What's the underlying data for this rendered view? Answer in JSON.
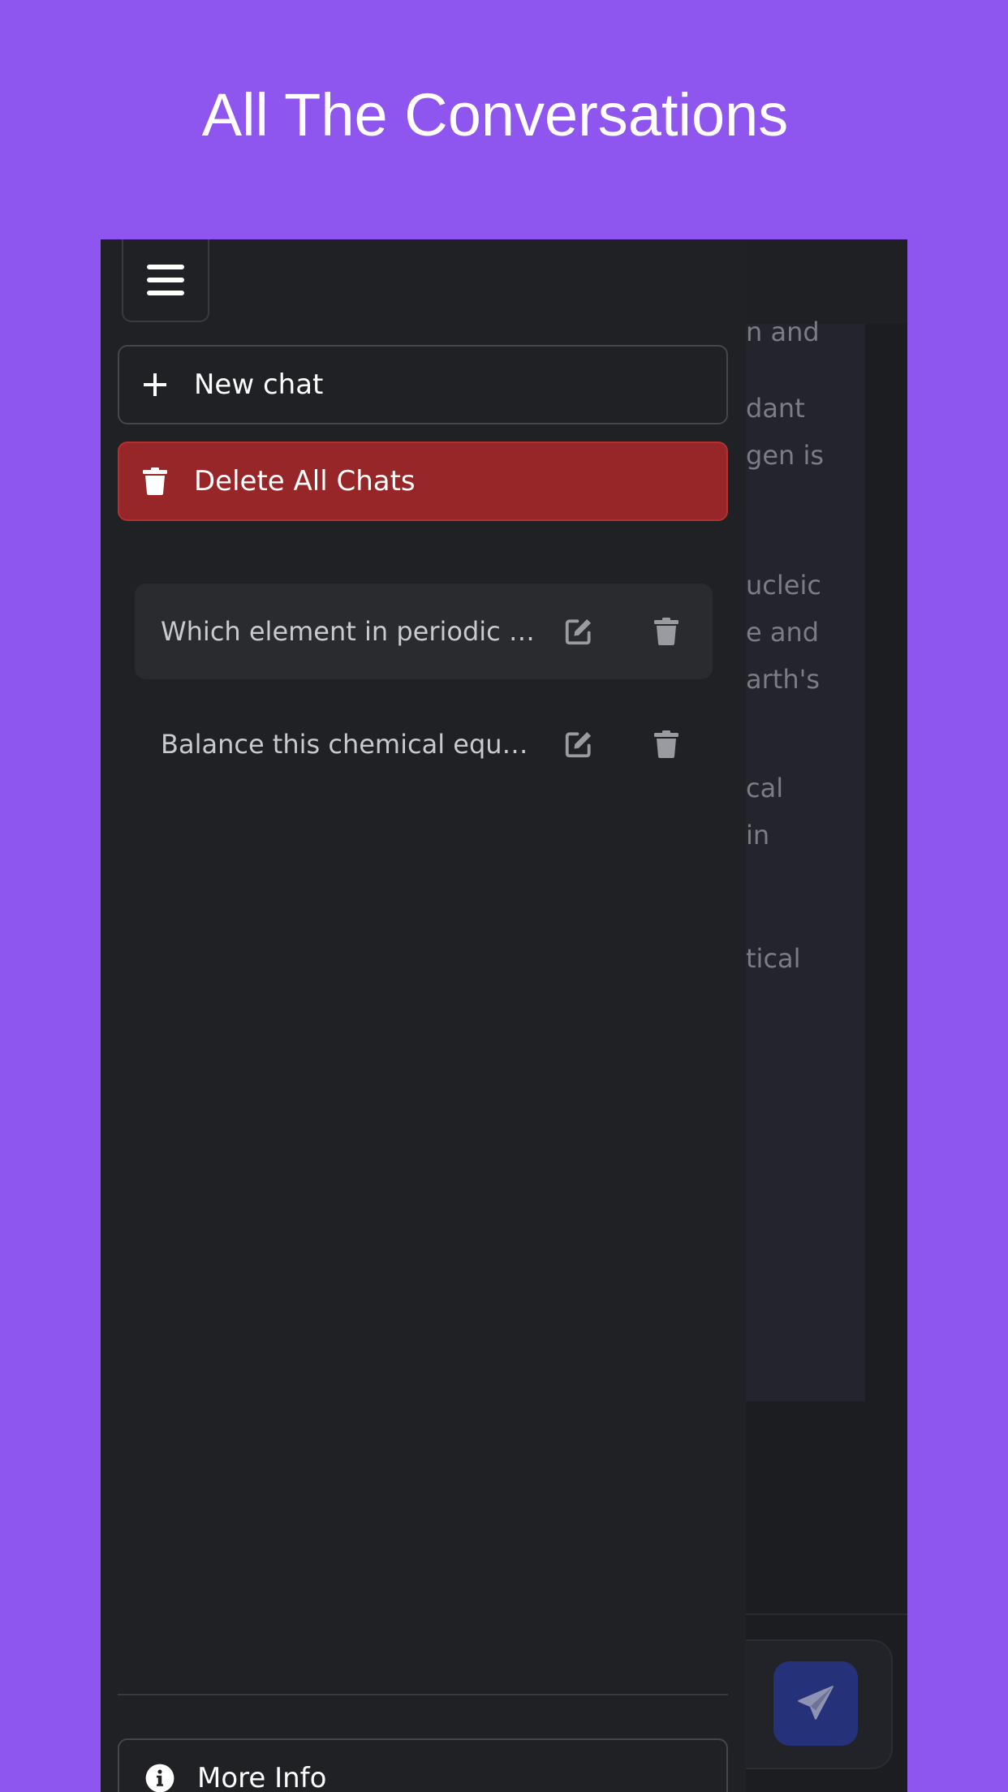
{
  "banner": {
    "title": "All The Conversations"
  },
  "background_chat": {
    "visible_fragments": [
      "n and",
      "dant",
      "gen is",
      "ucleic",
      "e and",
      "arth's",
      "cal",
      "in",
      "tical"
    ]
  },
  "sidebar": {
    "menu_icon": "hamburger-menu-icon",
    "new_chat_label": "New chat",
    "new_chat_icon": "plus-icon",
    "delete_all_label": "Delete All Chats",
    "delete_all_icon": "trash-icon",
    "conversations": [
      {
        "title": "Which element in periodic table is the most abundant",
        "active": true,
        "edit_icon": "edit-icon",
        "delete_icon": "trash-icon"
      },
      {
        "title": "Balance this chemical equation",
        "active": false,
        "edit_icon": "edit-icon",
        "delete_icon": "trash-icon"
      }
    ],
    "more_info_label": "More Info",
    "more_info_icon": "info-icon"
  },
  "composer": {
    "send_icon": "paper-plane-icon"
  },
  "colors": {
    "page_background": "#8e56ef",
    "drawer_background": "#202124",
    "danger": "#962627",
    "send_button": "#253279"
  }
}
